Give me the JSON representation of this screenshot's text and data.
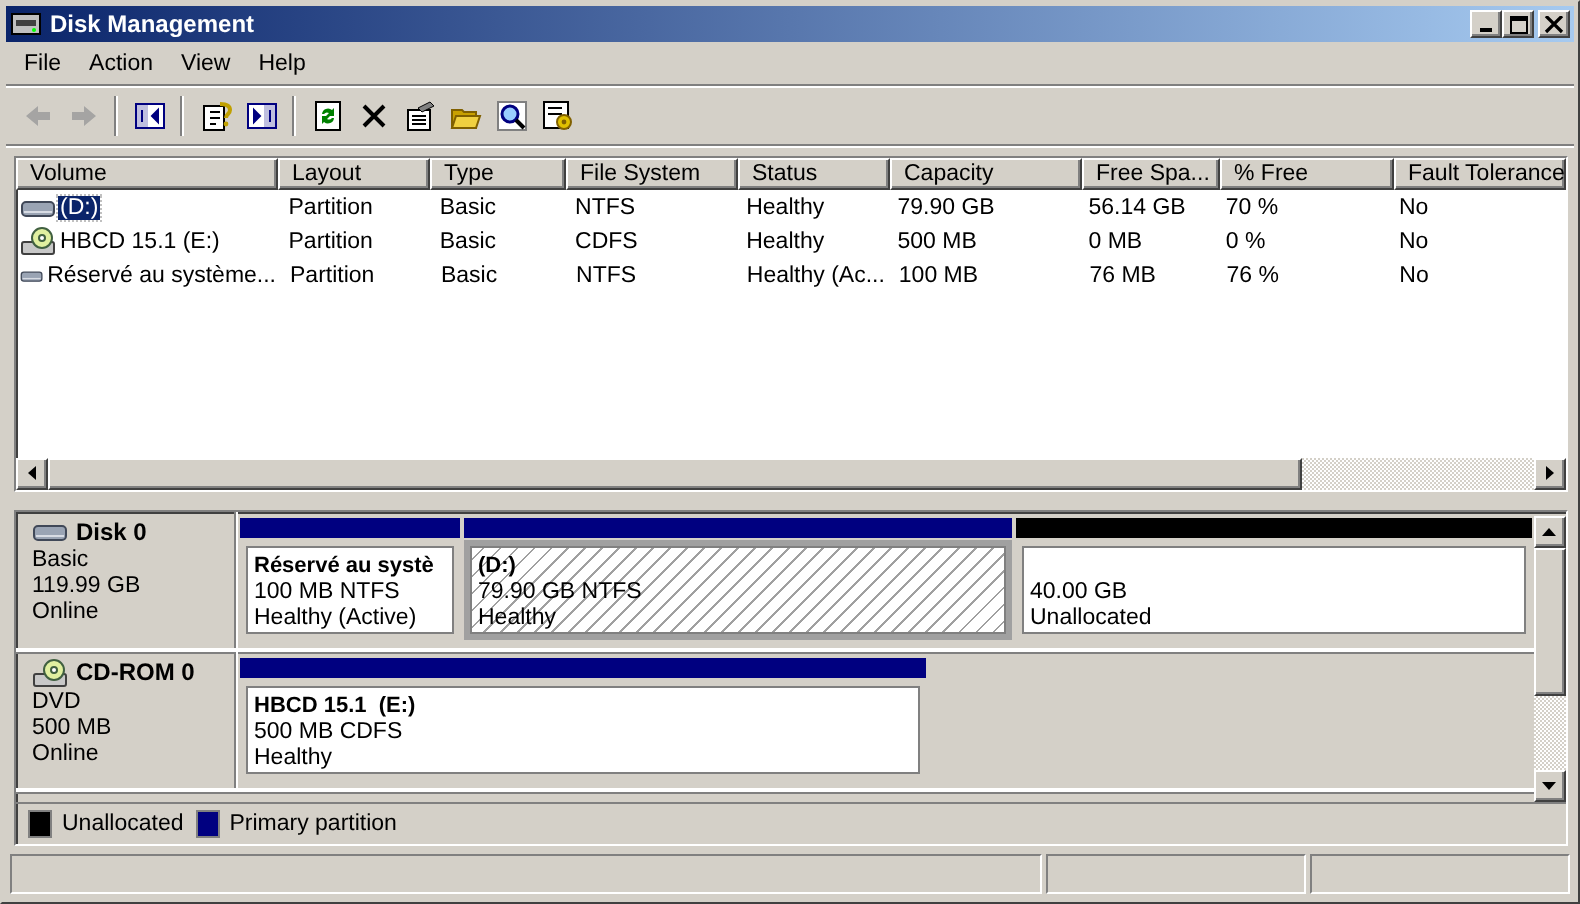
{
  "window": {
    "title": "Disk Management"
  },
  "menu": [
    {
      "label": "File"
    },
    {
      "label": "Action"
    },
    {
      "label": "View"
    },
    {
      "label": "Help"
    }
  ],
  "toolbar": [
    {
      "buttons": [
        {
          "kind": "back",
          "disabled": true
        },
        {
          "kind": "forward",
          "disabled": true
        }
      ]
    },
    {
      "buttons": [
        {
          "kind": "tree",
          "disabled": false
        }
      ]
    },
    {
      "buttons": [
        {
          "kind": "help",
          "disabled": false
        },
        {
          "kind": "pane",
          "disabled": false
        }
      ]
    },
    {
      "buttons": [
        {
          "kind": "refresh",
          "disabled": false
        },
        {
          "kind": "delete",
          "disabled": false
        },
        {
          "kind": "properties",
          "disabled": false
        },
        {
          "kind": "open",
          "disabled": false
        },
        {
          "kind": "search",
          "disabled": false
        },
        {
          "kind": "settings",
          "disabled": false
        }
      ]
    }
  ],
  "volume_list": {
    "columns": [
      "Volume",
      "Layout",
      "Type",
      "File System",
      "Status",
      "Capacity",
      "Free Spa...",
      "% Free",
      "Fault Tolerance"
    ],
    "rows": [
      {
        "kind": "disk",
        "selected": true,
        "cells": [
          "(D:)",
          "Partition",
          "Basic",
          "NTFS",
          "Healthy",
          "79.90 GB",
          "56.14 GB",
          "70 %",
          "No"
        ]
      },
      {
        "kind": "cdrom",
        "selected": false,
        "cells": [
          "HBCD 15.1 (E:)",
          "Partition",
          "Basic",
          "CDFS",
          "Healthy",
          "500 MB",
          "0 MB",
          "0 %",
          "No"
        ]
      },
      {
        "kind": "disk",
        "selected": false,
        "cells": [
          "Réservé au système...",
          "Partition",
          "Basic",
          "NTFS",
          "Healthy (Ac...",
          "100 MB",
          "76 MB",
          "76 %",
          "No"
        ]
      }
    ]
  },
  "disks": [
    {
      "kind": "disk",
      "name": "Disk 0",
      "type": "Basic",
      "size": "119.99 GB",
      "status": "Online",
      "partitions": [
        {
          "kind": "primary",
          "name": "Réservé au systè",
          "size": "100 MB NTFS",
          "status": "Healthy (Active)",
          "selected": false
        },
        {
          "kind": "primary",
          "name": "(D:)",
          "size": "79.90 GB NTFS",
          "status": "Healthy",
          "selected": true
        },
        {
          "kind": "unallocated",
          "size": "40.00 GB",
          "status": "Unallocated",
          "selected": false
        }
      ]
    },
    {
      "kind": "cdrom",
      "name": "CD-ROM 0",
      "type": "DVD",
      "size": "500 MB",
      "status": "Online",
      "partitions": [
        {
          "kind": "primary",
          "name": "HBCD 15.1  (E:)",
          "size": "500 MB CDFS",
          "status": "Healthy",
          "selected": false
        }
      ]
    }
  ],
  "legend": [
    {
      "label": "Unallocated",
      "color": "#000000"
    },
    {
      "label": "Primary partition",
      "color": "#000080"
    }
  ]
}
